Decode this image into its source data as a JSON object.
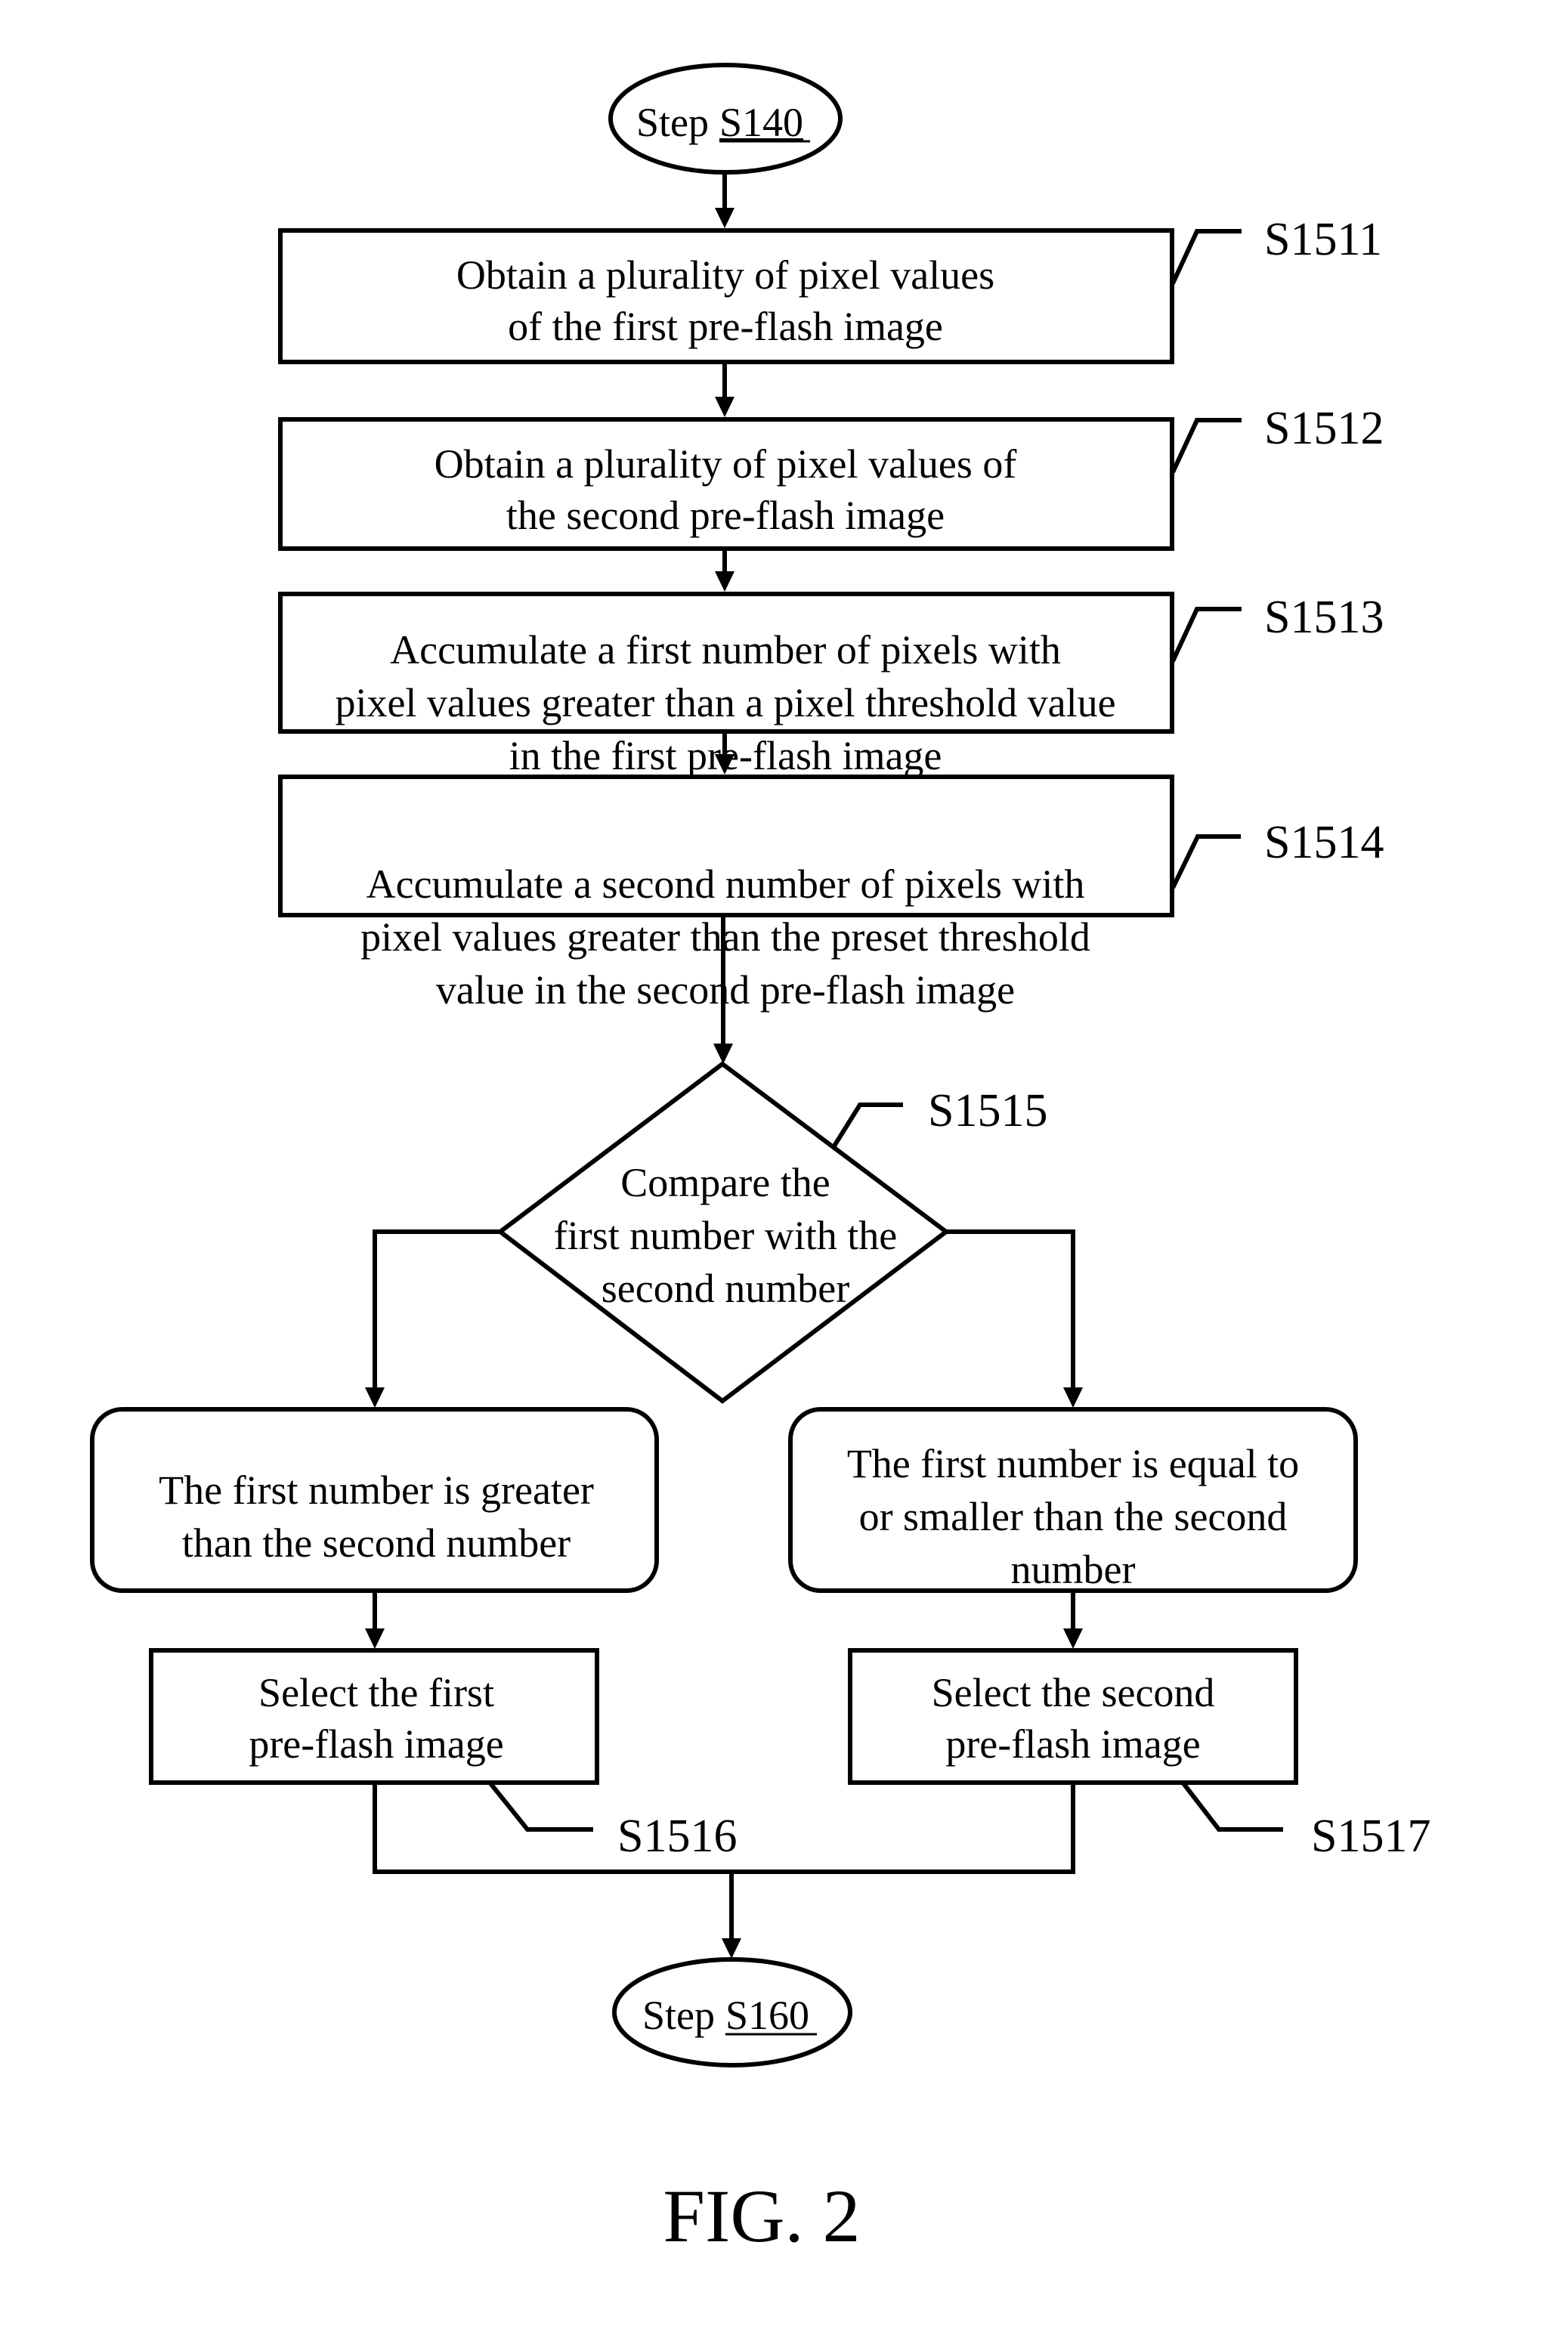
{
  "figure_label": "FIG. 2",
  "terminals": {
    "start": {
      "prefix": "Step ",
      "ref": "S140"
    },
    "end": {
      "prefix": "Step ",
      "ref": "S160"
    }
  },
  "steps": [
    {
      "id": "S1511",
      "lines": [
        "Obtain a plurality of pixel values",
        "of the first pre-flash image"
      ]
    },
    {
      "id": "S1512",
      "lines": [
        "Obtain a plurality of pixel values of",
        "the second pre-flash image"
      ]
    },
    {
      "id": "S1513",
      "lines": [
        "Accumulate a first number of pixels with",
        "pixel values greater than a pixel threshold value",
        "in the first pre-flash image"
      ]
    },
    {
      "id": "S1514",
      "lines": [
        "Accumulate a second number of pixels with",
        "pixel values greater than the preset threshold",
        "value in the second pre-flash image"
      ]
    }
  ],
  "decision": {
    "id": "S1515",
    "lines": [
      "Compare the",
      "first number with the",
      "second number"
    ]
  },
  "conditions": {
    "left": {
      "lines": [
        "The first number is greater",
        "than the second number"
      ]
    },
    "right": {
      "lines": [
        "The first number is equal to",
        "or smaller than the second",
        "number"
      ]
    }
  },
  "selections": {
    "left": {
      "id": "S1516",
      "lines": [
        "Select the first",
        "pre-flash image"
      ]
    },
    "right": {
      "id": "S1517",
      "lines": [
        "Select the second",
        "pre-flash image"
      ]
    }
  }
}
